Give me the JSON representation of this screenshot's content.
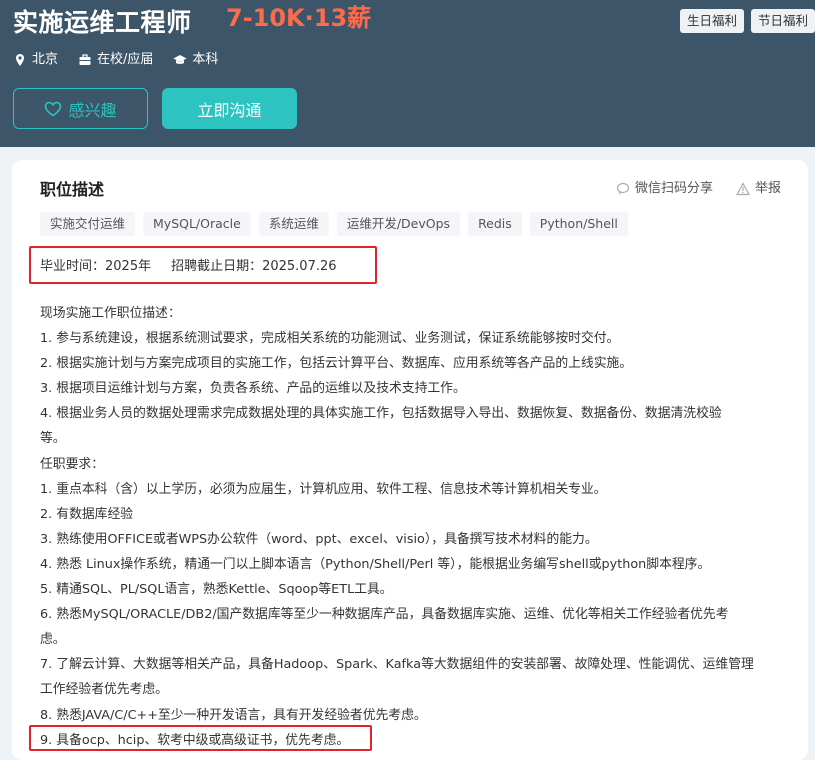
{
  "header": {
    "title": "实施运维工程师",
    "salary": "7-10K·13薪",
    "welfare_tags": [
      "生日福利",
      "节日福利"
    ],
    "meta": {
      "location": "北京",
      "experience": "在校/应届",
      "degree": "本科"
    },
    "buttons": {
      "interest": "感兴趣",
      "chat": "立即沟通"
    }
  },
  "card": {
    "section_title": "职位描述",
    "share_label": "微信扫码分享",
    "report_label": "举报",
    "skills": [
      "实施交付运维",
      "MySQL/Oracle",
      "系统运维",
      "运维开发/DevOps",
      "Redis",
      "Python/Shell"
    ],
    "graduation": {
      "year_text": "毕业时间：2025年",
      "deadline_text": "招聘截止日期：2025.07.26"
    },
    "description_lines": [
      "现场实施工作职位描述：",
      "1. 参与系统建设，根据系统测试要求，完成相关系统的功能测试、业务测试，保证系统能够按时交付。",
      "2. 根据实施计划与方案完成项目的实施工作，包括云计算平台、数据库、应用系统等各产品的上线实施。",
      "3. 根据项目运维计划与方案，负责各系统、产品的运维以及技术支持工作。",
      "4. 根据业务人员的数据处理需求完成数据处理的具体实施工作，包括数据导入导出、数据恢复、数据备份、数据清洗校验",
      "等。",
      "任职要求：",
      "1. 重点本科（含）以上学历，必须为应届生，计算机应用、软件工程、信息技术等计算机相关专业。",
      "2. 有数据库经验",
      "3. 熟练使用OFFICE或者WPS办公软件（word、ppt、excel、visio），具备撰写技术材料的能力。",
      "4. 熟悉 Linux操作系统，精通一门以上脚本语言（Python/Shell/Perl 等），能根据业务编写shell或python脚本程序。",
      "5. 精通SQL、PL/SQL语言，熟悉Kettle、Sqoop等ETL工具。",
      "6. 熟悉MySQL/ORACLE/DB2/国产数据库等至少一种数据库产品，具备数据库实施、运维、优化等相关工作经验者优先考",
      "虑。",
      "7. 了解云计算、大数据等相关产品，具备Hadoop、Spark、Kafka等大数据组件的安装部署、故障处理、性能调优、运维管理",
      "工作经验者优先考虑。",
      "8. 熟悉JAVA/C/C++至少一种开发语言，具有开发经验者优先考虑。",
      "9. 具备ocp、hcip、软考中级或高级证书，优先考虑。"
    ]
  },
  "colors": {
    "header_bg": "#3d5568",
    "salary": "#ff6b4a",
    "accent": "#2cc3c1",
    "annotation_red": "#e0242d"
  }
}
